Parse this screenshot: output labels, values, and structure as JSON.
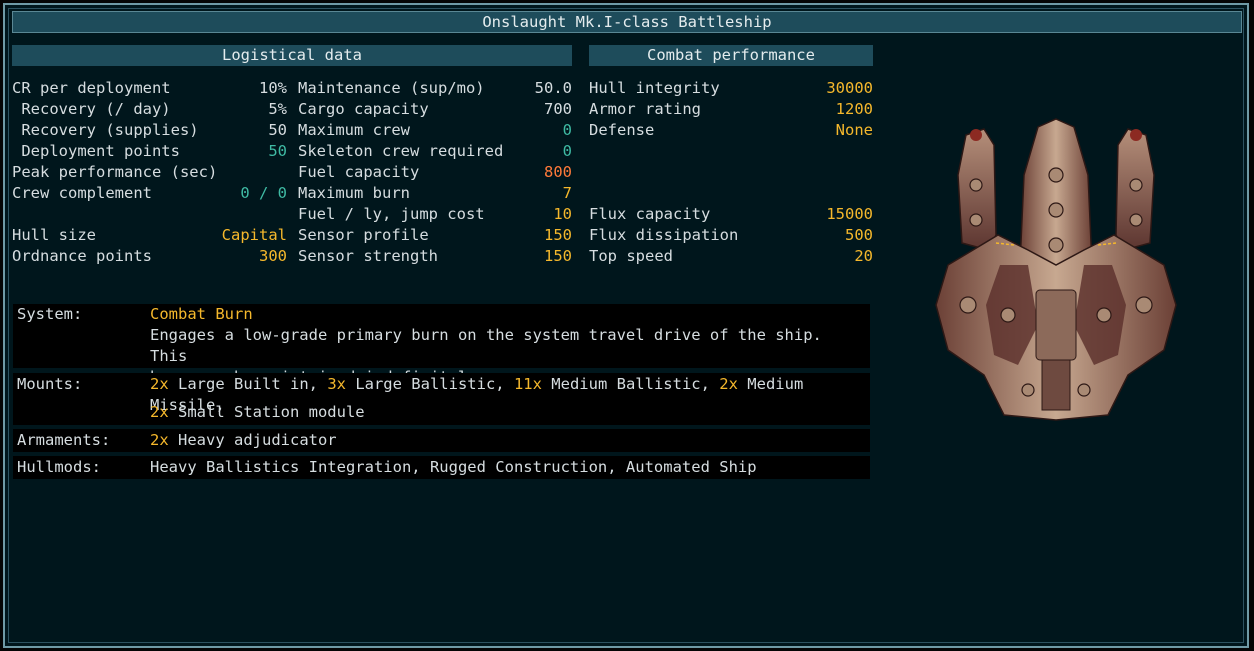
{
  "title": "Onslaught Mk.I-class Battleship",
  "sections": {
    "logistical": "Logistical data",
    "combat": "Combat performance"
  },
  "logistics_col1": [
    {
      "label": "CR per deployment",
      "value": "10%",
      "color": "#d6dde0"
    },
    {
      "label": " Recovery (/ day)",
      "value": "5%",
      "color": "#d6dde0"
    },
    {
      "label": " Recovery (supplies)",
      "value": "50",
      "color": "#d6dde0"
    },
    {
      "label": " Deployment points",
      "value": "50",
      "color": "#3fbba4"
    },
    {
      "label": "Peak performance (sec)",
      "value": "",
      "color": "#d6dde0"
    },
    {
      "label": "Crew complement",
      "value": "0 / 0",
      "color": "#3fbba4"
    },
    {
      "label": "",
      "value": "",
      "color": "#d6dde0"
    },
    {
      "label": "Hull size",
      "value": "Capital",
      "color": "#f5b82c"
    },
    {
      "label": "Ordnance points",
      "value": "300",
      "color": "#f5b82c"
    }
  ],
  "logistics_col2": [
    {
      "label": "Maintenance (sup/mo)",
      "value": "50.0",
      "color": "#d6dde0"
    },
    {
      "label": "Cargo capacity",
      "value": "700",
      "color": "#d6dde0"
    },
    {
      "label": "Maximum crew",
      "value": "0",
      "color": "#3fbba4"
    },
    {
      "label": "Skeleton crew required",
      "value": "0",
      "color": "#3fbba4"
    },
    {
      "label": "Fuel capacity",
      "value": "800",
      "color": "#ff7a3a"
    },
    {
      "label": "Maximum burn",
      "value": "7",
      "color": "#f5b82c"
    },
    {
      "label": "Fuel / ly, jump cost",
      "value": "10",
      "color": "#f5b82c"
    },
    {
      "label": "Sensor profile",
      "value": "150",
      "color": "#f5b82c"
    },
    {
      "label": "Sensor strength",
      "value": "150",
      "color": "#f5b82c"
    }
  ],
  "combat": [
    {
      "label": "Hull integrity",
      "value": "30000",
      "color": "#f5b82c"
    },
    {
      "label": "Armor rating",
      "value": "1200",
      "color": "#f5b82c"
    },
    {
      "label": "Defense",
      "value": "None",
      "color": "#f5b82c"
    },
    {
      "label": "",
      "value": "",
      "color": "#d6dde0"
    },
    {
      "label": "",
      "value": "",
      "color": "#d6dde0"
    },
    {
      "label": "",
      "value": "",
      "color": "#d6dde0"
    },
    {
      "label": "Flux capacity",
      "value": "15000",
      "color": "#f5b82c"
    },
    {
      "label": "Flux dissipation",
      "value": "500",
      "color": "#f5b82c"
    },
    {
      "label": "Top speed",
      "value": "20",
      "color": "#f5b82c"
    }
  ],
  "system": {
    "label": "System:",
    "name": "Combat Burn",
    "line1": "Engages a low-grade primary burn on the system travel drive of the ship. This",
    "line2": "burn can be maintained indefinitely."
  },
  "mounts": {
    "label": "Mounts:",
    "items": [
      {
        "count": "2x",
        "text": " Large Built in, "
      },
      {
        "count": "3x",
        "text": " Large Ballistic, "
      },
      {
        "count": "11x",
        "text": " Medium Ballistic, "
      },
      {
        "count": "2x",
        "text": " Medium Missile,"
      },
      {
        "count": "2x",
        "text": " Small Station module"
      }
    ]
  },
  "armaments": {
    "label": "Armaments:",
    "count": "2x",
    "text": " Heavy adjudicator"
  },
  "hullmods": {
    "label": "Hullmods:",
    "text": "Heavy Ballistics Integration, Rugged Construction, Automated Ship"
  },
  "colors": {
    "amber": "#f5b82c",
    "teal": "#3fbba4",
    "orange": "#ff7a3a",
    "frame": "#6f9aa6",
    "bar": "#1e4c5b"
  },
  "ship_image": "ship-sprite-icon"
}
